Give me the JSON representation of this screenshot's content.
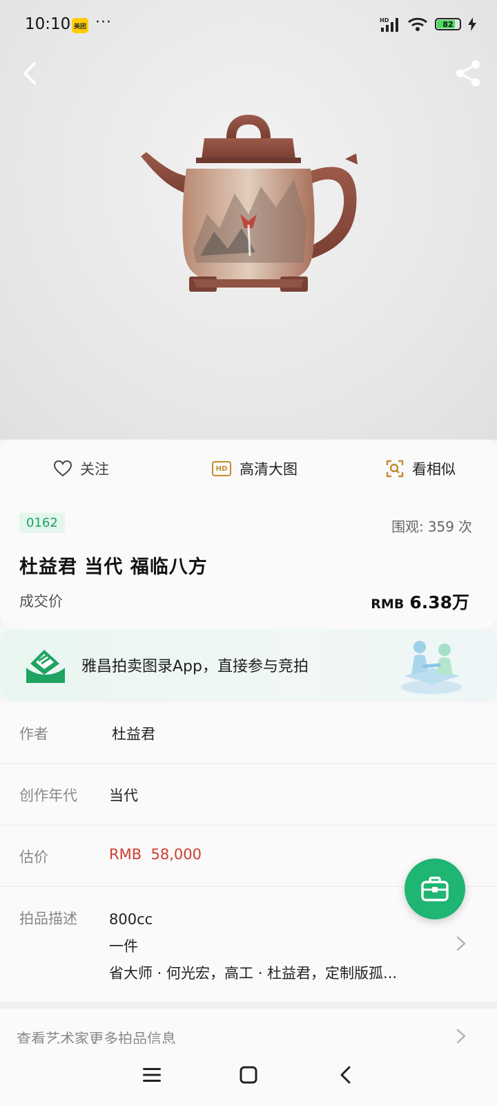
{
  "status_bar": {
    "time": "10:10",
    "app_badge": "美团",
    "more": "···",
    "battery": "82",
    "battery_level": 0.82
  },
  "hero": {
    "back_icon": "chevron-left-icon",
    "share_icon": "share-icon",
    "image": "painted-zisha-teapot"
  },
  "actions": {
    "follow": "关注",
    "hd_badge": "HD",
    "hd": "高清大图",
    "similar": "看相似"
  },
  "lot": {
    "number": "0162",
    "views_label": "围观:",
    "views_count": "359",
    "views_unit": "次",
    "title": "杜益君 当代 福临八方",
    "deal_label": "成交价",
    "deal_currency": "RMB",
    "deal_value": "6.38万"
  },
  "banner": {
    "text": "雅昌拍卖图录App，直接参与竞拍"
  },
  "info": {
    "author_label": "作者",
    "author_value": "杜益君",
    "era_label": "创作年代",
    "era_value": "当代",
    "estimate_label": "估价",
    "estimate_value": "RMB  58,000",
    "desc_label": "拍品描述",
    "desc_lines": [
      "800cc",
      "一件",
      "省大师 · 何光宏，高工 · 杜益君，定制版孤..."
    ]
  },
  "more": {
    "text": "查看艺术家更多拍品信息"
  },
  "colors": {
    "accent_green": "#1fb572",
    "price_red": "#d03c32",
    "badge_green": "#1aa464",
    "hd_gold": "#c48a2c"
  }
}
